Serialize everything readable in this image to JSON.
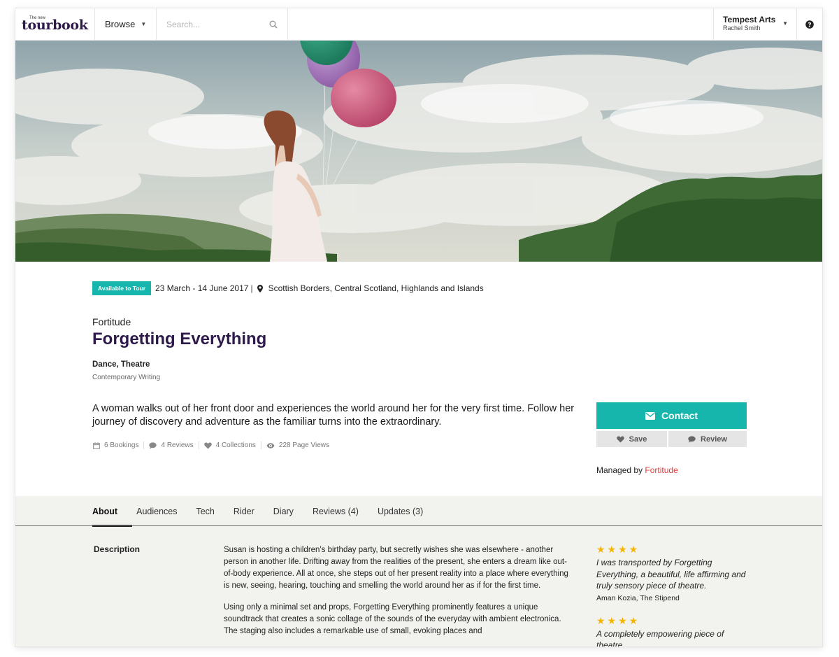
{
  "header": {
    "logo_small": "The new",
    "logo": "tourbook",
    "browse_label": "Browse",
    "search_placeholder": "Search...",
    "account_org": "Tempest Arts",
    "account_user": "Rachel Smith"
  },
  "show": {
    "badge": "Available to Tour",
    "dates": "23 March - 14 June 2017",
    "date_separator": "|",
    "locations": "Scottish Borders, Central Scotland, Highlands and Islands",
    "company": "Fortitude",
    "title": "Forgetting Everything",
    "genres": "Dance, Theatre",
    "subgenre": "Contemporary Writing",
    "summary": "A woman walks out of her front door and experiences the world around her for the very first time. Follow her journey of discovery and adventure as the familiar turns into the extraordinary.",
    "stats": {
      "bookings": "6 Bookings",
      "reviews": "4 Reviews",
      "collections": "4 Collections",
      "views": "228 Page Views"
    }
  },
  "actions": {
    "contact": "Contact",
    "save": "Save",
    "review": "Review",
    "managed_prefix": "Managed by",
    "managed_by": "Fortitude"
  },
  "tabs": [
    {
      "label": "About"
    },
    {
      "label": "Audiences"
    },
    {
      "label": "Tech"
    },
    {
      "label": "Rider"
    },
    {
      "label": "Diary"
    },
    {
      "label": "Reviews (4)"
    },
    {
      "label": "Updates (3)"
    }
  ],
  "about": {
    "label": "Description",
    "paragraphs": [
      "Susan is hosting a children's birthday party, but secretly wishes she was elsewhere - another person in another life. Drifting away from the realities of the present, she enters a dream like out-of-body experience. All at once, she steps out of her present reality into a place where everything is new, seeing, hearing, touching and smelling the world around her as if for the first time.",
      "Using only a minimal set and props, Forgetting Everything prominently features a unique soundtrack that creates a sonic collage of the sounds of the everyday with ambient electronica. The staging also includes a remarkable use of small, evoking places and"
    ]
  },
  "quotes": [
    {
      "stars": "★★★★",
      "text": "I was transported by Forgetting Everything, a beautiful, life affirming and truly sensory piece of theatre.",
      "source": "Aman Kozia, The Stipend"
    },
    {
      "stars": "★★★★",
      "text": "A completely empowering piece of theatre.",
      "source": ""
    }
  ],
  "colors": {
    "accent": "#17b6ad",
    "title": "#2e1a4a",
    "link": "#e33b3b",
    "star": "#f5b400"
  }
}
